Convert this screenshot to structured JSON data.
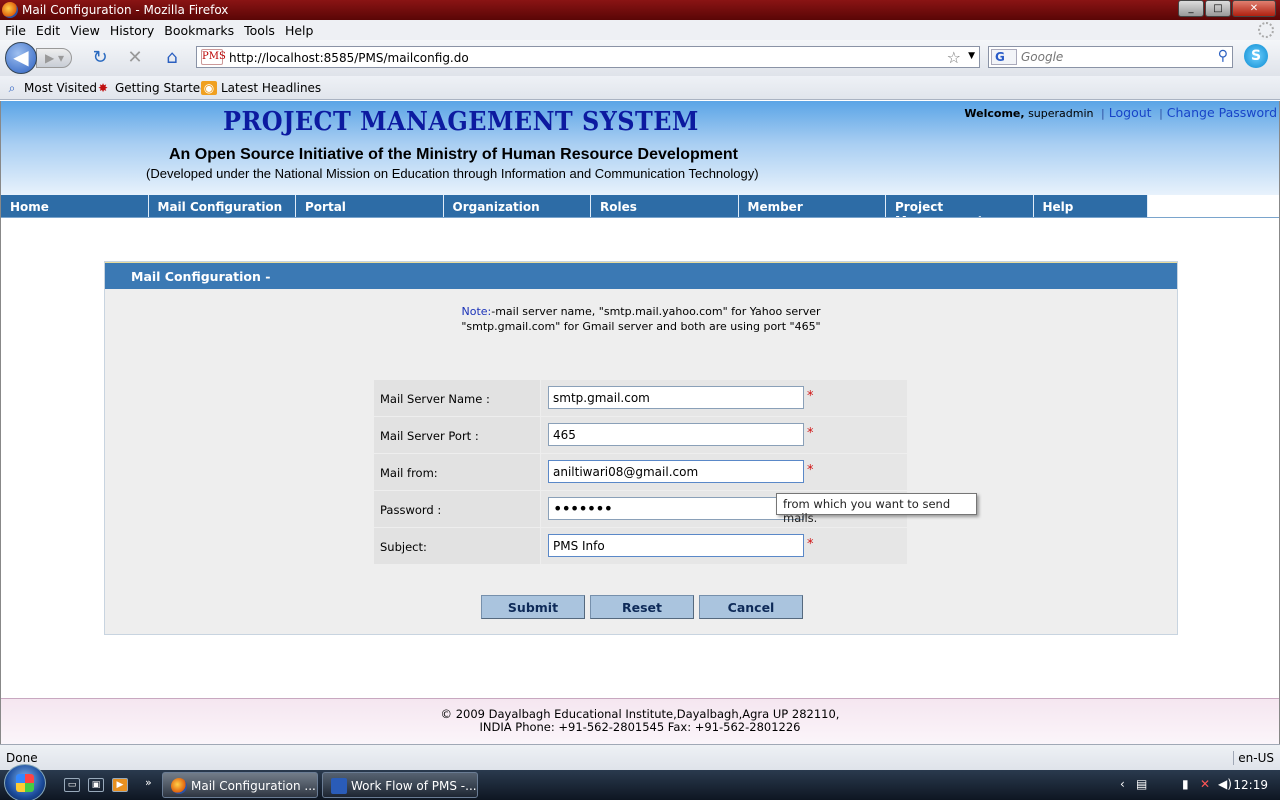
{
  "window": {
    "title": "Mail Configuration - Mozilla Firefox",
    "buttons": {
      "minimize": "_",
      "maximize": "□",
      "close": "✕"
    }
  },
  "menubar": {
    "items": [
      "File",
      "Edit",
      "View",
      "History",
      "Bookmarks",
      "Tools",
      "Help"
    ]
  },
  "navbar": {
    "url": "http://localhost:8585/PMS/mailconfig.do",
    "favicon_text": "PMS",
    "search_placeholder": "Google",
    "search_engine": "G"
  },
  "bookmarks": {
    "items": [
      "Most Visited",
      "Getting Started",
      "Latest Headlines"
    ]
  },
  "header": {
    "title": "PROJECT MANAGEMENT SYSTEM",
    "subtitle": "An Open Source Initiative of the Ministry of Human Resource Development",
    "devnote": "(Developed under the National Mission on Education through Information and Communication Technology)",
    "welcome_label": "Welcome,",
    "username": "superadmin",
    "sep": "|",
    "logout": "Logout",
    "change_password": "Change Password"
  },
  "topnav": {
    "items": [
      "Home",
      "Mail Configuration",
      "Portal",
      "Organization",
      "Roles",
      "Member",
      "Project Management",
      "Help"
    ]
  },
  "panel": {
    "heading": "Mail Configuration -",
    "note_label": "Note:",
    "note_line1": "-mail server name, \"smtp.mail.yahoo.com\" for Yahoo server",
    "note_line2": "\"smtp.gmail.com\" for Gmail server and both are using port \"465\"",
    "required_mark": "*",
    "fields": [
      {
        "label": "Mail Server Name :",
        "value": "smtp.gmail.com"
      },
      {
        "label": "Mail Server Port :",
        "value": "465"
      },
      {
        "label": "Mail from:",
        "value": "aniltiwari08@gmail.com"
      },
      {
        "label": "Password :",
        "value": "•••••••"
      },
      {
        "label": "Subject:",
        "value": "PMS Info"
      }
    ],
    "tooltip": "from which you want to send mails.",
    "buttons": {
      "submit": "Submit",
      "reset": "Reset",
      "cancel": "Cancel"
    }
  },
  "footer": {
    "line1": "© 2009 Dayalbagh Educational Institute,Dayalbagh,Agra UP 282110,",
    "line2": "INDIA Phone: +91-562-2801545 Fax: +91-562-2801226"
  },
  "statusbar": {
    "status": "Done",
    "locale": "en-US"
  },
  "taskbar": {
    "tasks": [
      "Mail Configuration ...",
      "Work Flow of PMS -..."
    ],
    "chevron": "»",
    "clock": "12:19"
  }
}
